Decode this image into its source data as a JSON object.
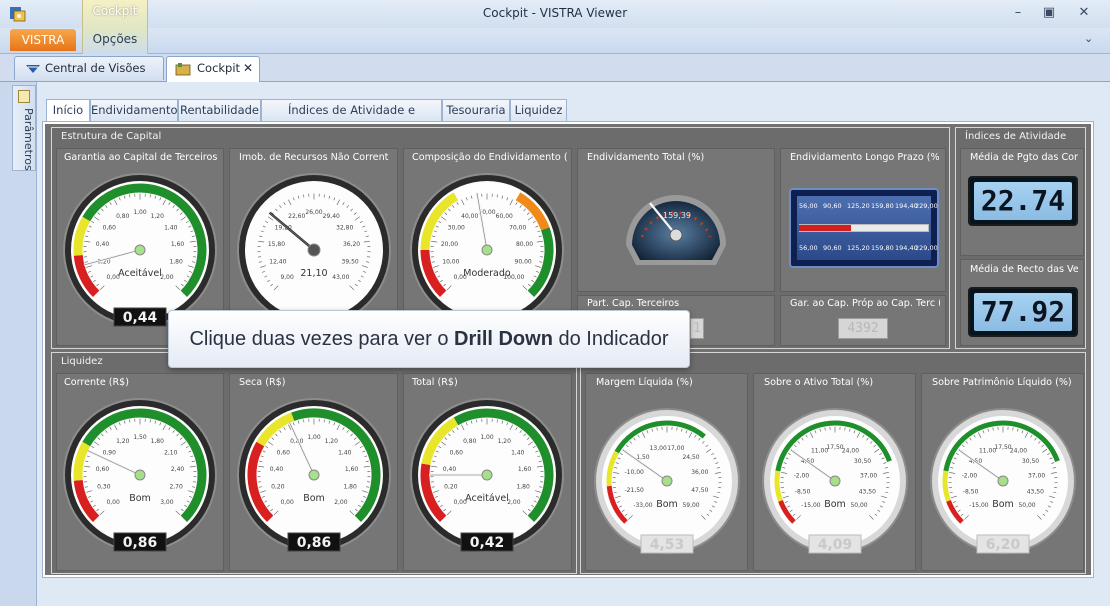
{
  "window": {
    "title": "Cockpit - VISTRA Viewer"
  },
  "ribbon": {
    "app_tab": "VISTRA",
    "context_group": "Cockpit",
    "options_tab": "Opções"
  },
  "doc_tabs": [
    {
      "label": "Central de Visões SPED"
    },
    {
      "label": "Cockpit"
    }
  ],
  "side_panel": {
    "label": "Parâmetros"
  },
  "tabs": [
    "Início",
    "Endividamento",
    "Rentabilidade",
    "Índices de Atividade e Insolvência",
    "Tesouraria",
    "Liquidez"
  ],
  "colors": {
    "accent": "#e7741a",
    "gauge_green": "#1f8f2b",
    "gauge_yellow": "#e9e52a",
    "gauge_red": "#d92020",
    "dashboard_bg": "#717171"
  },
  "groups": {
    "estrutura": "Estrutura de Capital",
    "indices": "Índices de Atividade",
    "liquidez": "Liquidez"
  },
  "panels": {
    "garantia": "Garantia ao Capital de Terceiros (R$",
    "imob": "Imob. de Recursos Não Correntes (",
    "composicao": "Composição do Endividamento (%)",
    "endiv_total": "Endividamento Total (%)",
    "endiv_lp": "Endividamento Longo Prazo (%)",
    "media_pgto": "Média de Pgto das Comp",
    "part_cap": "Part. Cap. Terceiros",
    "gar_cap_prop": "Gar. ao Cap. Próp ao Cap. Terc (%",
    "media_recto": "Média de Recto das Ven",
    "corrente": "Corrente (R$)",
    "seca": "Seca (R$)",
    "total": "Total (R$)",
    "margem": "Margem Líquida (%)",
    "ativo_total": "Sobre o Ativo Total (%)",
    "patrimonio": "Sobre Patrimônio Líquido (%)"
  },
  "gauges": {
    "garantia": {
      "status": "Aceitável",
      "value": "0,44",
      "ticks": [
        "0,00",
        "0,20",
        "0,40",
        "0,60",
        "0,80",
        "1,00",
        "1,20",
        "1,40",
        "1,60",
        "1,80",
        "2,00"
      ]
    },
    "imob": {
      "status": "",
      "center": "21,10",
      "ticks": [
        "9,00",
        "12,40",
        "15,80",
        "19,20",
        "22,60",
        "26,00",
        "29,40",
        "32,80",
        "36,20",
        "39,50",
        "43,00"
      ]
    },
    "composicao": {
      "status": "Moderado",
      "ticks": [
        "0,00",
        "10,00",
        "20,00",
        "30,00",
        "40,00",
        "50,00",
        "60,00",
        "70,00",
        "80,00",
        "90,00",
        "100,00"
      ]
    },
    "endiv_total": {
      "center": "159,39"
    },
    "corrente": {
      "status": "Bom",
      "value": "0,86",
      "ticks": [
        "0,00",
        "0,30",
        "0,60",
        "0,90",
        "1,20",
        "1,50",
        "1,80",
        "2,10",
        "2,40",
        "2,70",
        "3,00"
      ]
    },
    "seca": {
      "status": "Bom",
      "value": "0,86",
      "ticks": [
        "0,00",
        "0,20",
        "0,40",
        "0,60",
        "0,80",
        "1,00",
        "1,20",
        "1,40",
        "1,60",
        "1,80",
        "2,00"
      ]
    },
    "total": {
      "status": "Aceitável",
      "value": "0,42",
      "ticks": [
        "0,00",
        "0,20",
        "0,40",
        "0,60",
        "0,80",
        "1,00",
        "1,20",
        "1,40",
        "1,60",
        "1,80",
        "2,00"
      ]
    },
    "margem": {
      "status": "Bom",
      "value": "4,53",
      "ticks": [
        "-33,00",
        "-21,50",
        "-10,00",
        "1,50",
        "13,00",
        "17,00",
        "24,50",
        "36,00",
        "47,50",
        "59,00"
      ]
    },
    "ativo_total": {
      "status": "Bom",
      "value": "4,09",
      "ticks": [
        "-15,00",
        "-8,50",
        "-2,00",
        "4,50",
        "11,00",
        "17,50",
        "24,00",
        "30,50",
        "37,00",
        "43,50",
        "50,00"
      ]
    },
    "patrimonio": {
      "status": "Bom",
      "value": "6,20",
      "ticks": [
        "-15,00",
        "-8,50",
        "-2,00",
        "4,50",
        "11,00",
        "17,50",
        "24,00",
        "30,50",
        "37,00",
        "43,50",
        "50,00"
      ]
    }
  },
  "bar_scale": [
    "56,00",
    "90,60",
    "125,20",
    "159,80",
    "194,40",
    "229,00"
  ],
  "lcd": {
    "media_pgto": "22.74",
    "media_recto": "77.92",
    "gar_cap_prop": "4392",
    "part_cap_partial": "1"
  },
  "tooltip": {
    "before": "Clique duas vezes para ver o ",
    "bold": "Drill Down",
    "after": " do Indicador"
  }
}
